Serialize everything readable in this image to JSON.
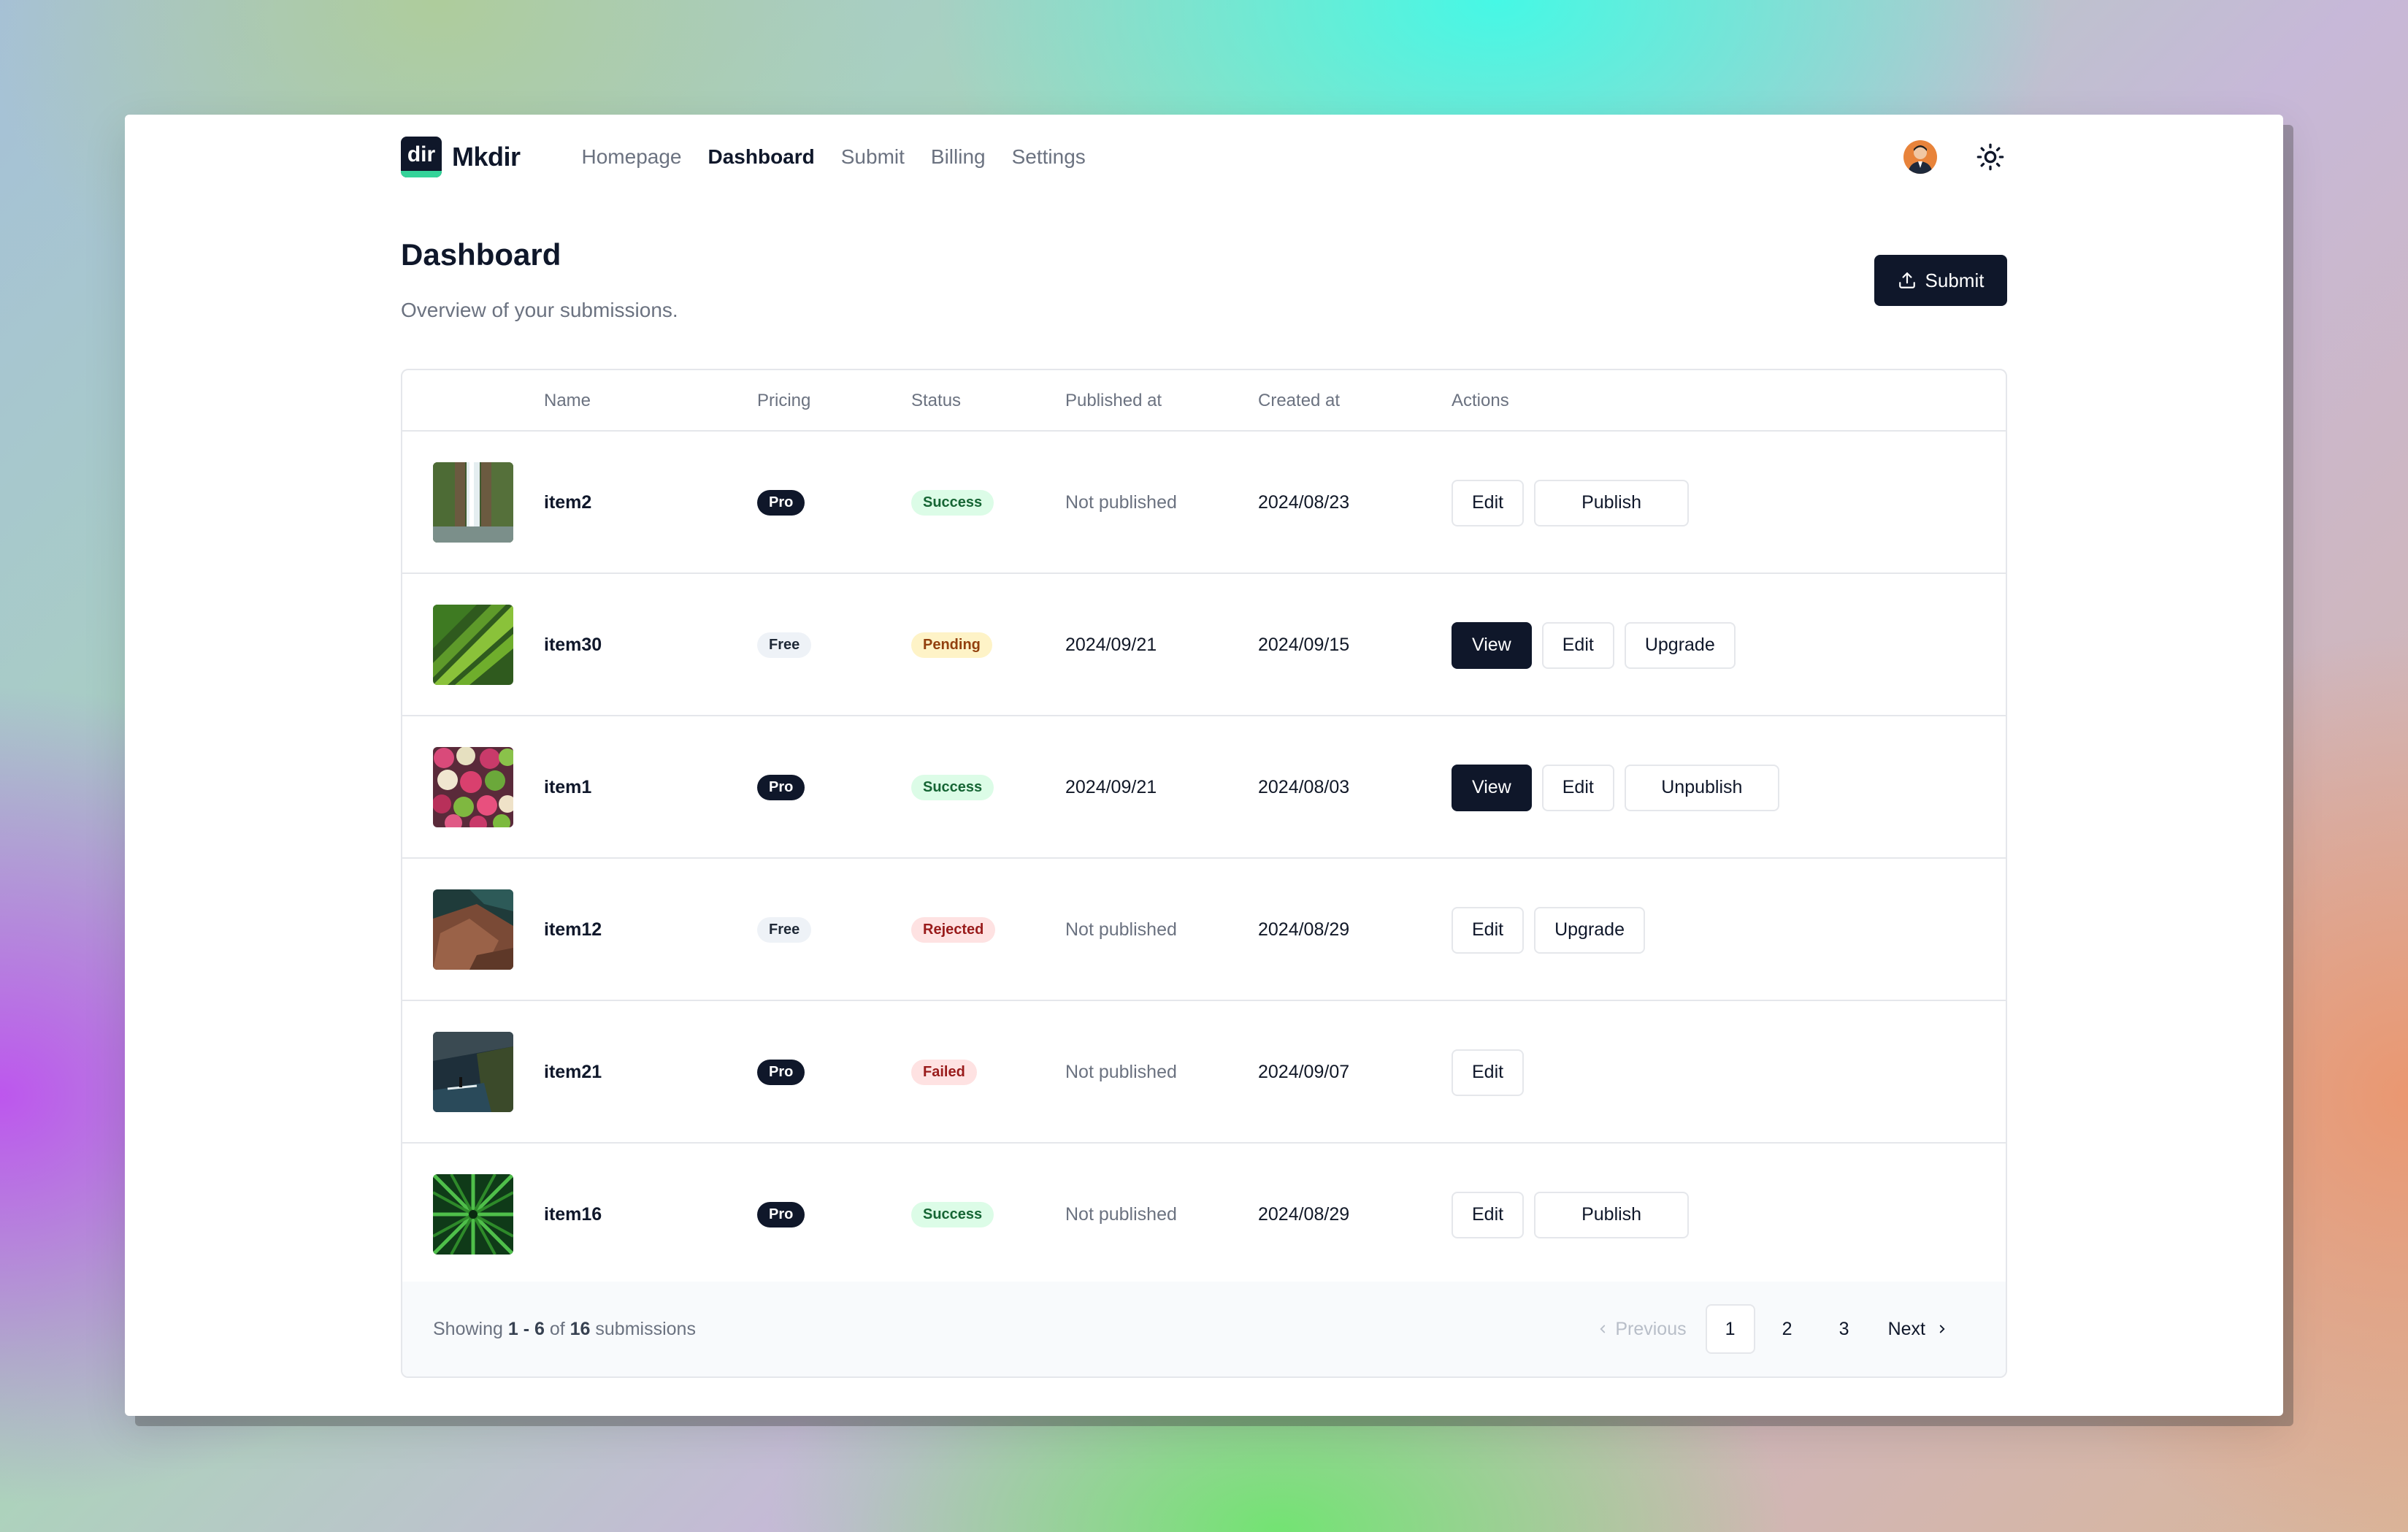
{
  "app": {
    "logo_text": "dir",
    "brand": "Mkdir"
  },
  "nav": [
    {
      "label": "Homepage",
      "active": false
    },
    {
      "label": "Dashboard",
      "active": true
    },
    {
      "label": "Submit",
      "active": false
    },
    {
      "label": "Billing",
      "active": false
    },
    {
      "label": "Settings",
      "active": false
    }
  ],
  "header": {
    "avatar_icon": "user-avatar",
    "theme_icon": "sun-icon"
  },
  "page": {
    "title": "Dashboard",
    "subtitle": "Overview of your submissions.",
    "submit_label": "Submit",
    "submit_icon": "upload-icon"
  },
  "table": {
    "columns": [
      "Name",
      "Pricing",
      "Status",
      "Published at",
      "Created at",
      "Actions"
    ],
    "rows": [
      {
        "name": "item2",
        "pricing": "Pro",
        "status": "Success",
        "published": "Not published",
        "created": "2024/08/23",
        "actions": [
          "Edit",
          "Publish"
        ],
        "thumb": "waterfall"
      },
      {
        "name": "item30",
        "pricing": "Free",
        "status": "Pending",
        "published": "2024/09/21",
        "created": "2024/09/15",
        "actions": [
          "View",
          "Edit",
          "Upgrade"
        ],
        "thumb": "palm-leaf"
      },
      {
        "name": "item1",
        "pricing": "Pro",
        "status": "Success",
        "published": "2024/09/21",
        "created": "2024/08/03",
        "actions": [
          "View",
          "Edit",
          "Unpublish"
        ],
        "thumb": "fruits"
      },
      {
        "name": "item12",
        "pricing": "Free",
        "status": "Rejected",
        "published": "Not published",
        "created": "2024/08/29",
        "actions": [
          "Edit",
          "Upgrade"
        ],
        "thumb": "rocks"
      },
      {
        "name": "item21",
        "pricing": "Pro",
        "status": "Failed",
        "published": "Not published",
        "created": "2024/09/07",
        "actions": [
          "Edit"
        ],
        "thumb": "cliff-sea"
      },
      {
        "name": "item16",
        "pricing": "Pro",
        "status": "Success",
        "published": "Not published",
        "created": "2024/08/29",
        "actions": [
          "Edit",
          "Publish"
        ],
        "thumb": "green-plant"
      }
    ]
  },
  "footer": {
    "showing_prefix": "Showing ",
    "range": "1 - 6",
    "of_text": " of ",
    "total": "16",
    "suffix": " submissions",
    "prev_label": "Previous",
    "next_label": "Next",
    "pages": [
      "1",
      "2",
      "3"
    ],
    "current_page": "1"
  },
  "colors": {
    "primary": "#0f172a",
    "accent": "#34d399",
    "success_bg": "#dcfce7",
    "pending_bg": "#fef3c7",
    "error_bg": "#fee2e2"
  }
}
